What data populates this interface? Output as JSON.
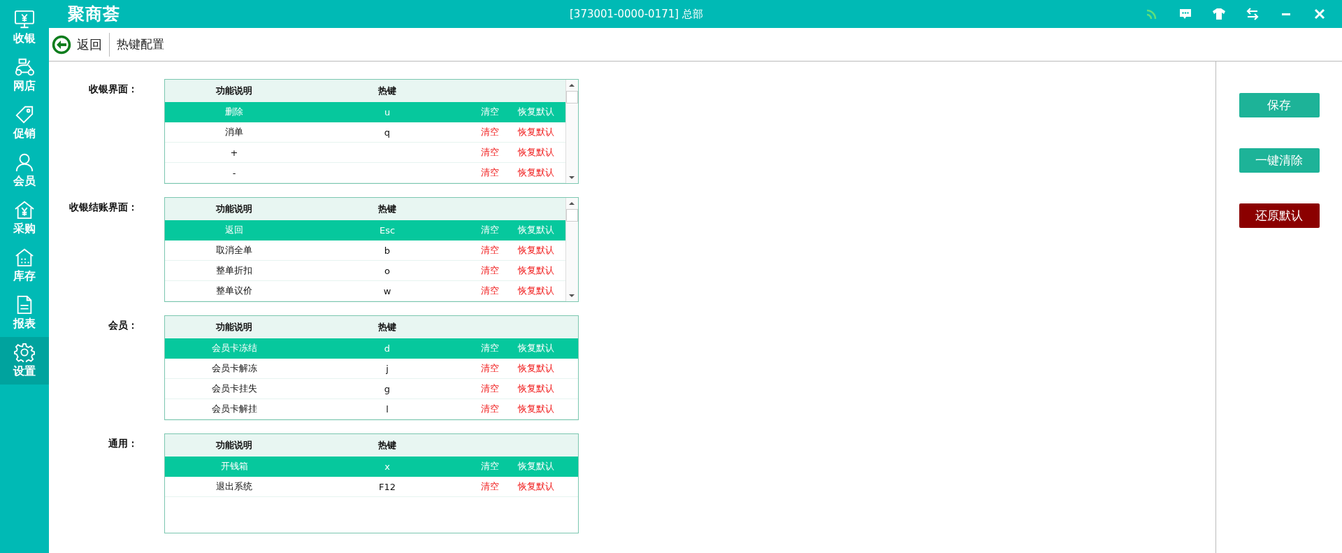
{
  "app": {
    "logo": "聚商荟",
    "store": "[373001-0000-0171] 总部"
  },
  "sidebar": {
    "items": [
      {
        "label": "收银",
        "kind": "register",
        "selected": false
      },
      {
        "label": "网店",
        "kind": "scooter",
        "selected": false
      },
      {
        "label": "促销",
        "kind": "tag",
        "selected": false
      },
      {
        "label": "会员",
        "kind": "person",
        "selected": false
      },
      {
        "label": "采购",
        "kind": "purchase",
        "selected": false
      },
      {
        "label": "库存",
        "kind": "warehouse",
        "selected": false
      },
      {
        "label": "报表",
        "kind": "report",
        "selected": false
      },
      {
        "label": "设置",
        "kind": "gear",
        "selected": true
      }
    ]
  },
  "header": {
    "back": "返回",
    "title": "热键配置"
  },
  "sections": [
    {
      "title": "收银界面：",
      "scrollbar": true,
      "columns": [
        "功能说明",
        "热键"
      ],
      "rows": [
        {
          "desc": "删除",
          "key": "u",
          "clear": "清空",
          "reset": "恢复默认",
          "selected": true
        },
        {
          "desc": "消单",
          "key": "q",
          "clear": "清空",
          "reset": "恢复默认",
          "selected": false
        },
        {
          "desc": "+",
          "clear": "清空",
          "reset": "恢复默认",
          "selected": false
        },
        {
          "desc": "-",
          "clear": "清空",
          "reset": "恢复默认",
          "selected": false
        }
      ]
    },
    {
      "title": "收银结账界面：",
      "scrollbar": true,
      "columns": [
        "功能说明",
        "热键"
      ],
      "rows": [
        {
          "desc": "返回",
          "key": "Esc",
          "clear": "清空",
          "reset": "恢复默认",
          "selected": true
        },
        {
          "desc": "取消全单",
          "key": "b",
          "clear": "清空",
          "reset": "恢复默认",
          "selected": false
        },
        {
          "desc": "整单折扣",
          "key": "o",
          "clear": "清空",
          "reset": "恢复默认",
          "selected": false
        },
        {
          "desc": "整单议价",
          "key": "w",
          "clear": "清空",
          "reset": "恢复默认",
          "selected": false
        }
      ]
    },
    {
      "title": "会员：",
      "scrollbar": false,
      "columns": [
        "功能说明",
        "热键"
      ],
      "rows": [
        {
          "desc": "会员卡冻结",
          "key": "d",
          "clear": "清空",
          "reset": "恢复默认",
          "selected": true
        },
        {
          "desc": "会员卡解冻",
          "key": "j",
          "clear": "清空",
          "reset": "恢复默认",
          "selected": false
        },
        {
          "desc": "会员卡挂失",
          "key": "g",
          "clear": "清空",
          "reset": "恢复默认",
          "selected": false
        },
        {
          "desc": "会员卡解挂",
          "key": "l",
          "clear": "清空",
          "reset": "恢复默认",
          "selected": false
        }
      ]
    },
    {
      "title": "通用：",
      "scrollbar": false,
      "columns": [
        "功能说明",
        "热键"
      ],
      "rows": [
        {
          "desc": "开钱箱",
          "key": "x",
          "clear": "清空",
          "reset": "恢复默认",
          "selected": true
        },
        {
          "desc": "退出系统",
          "key": "F12",
          "clear": "清空",
          "reset": "恢复默认",
          "selected": false
        }
      ]
    }
  ],
  "actions": [
    {
      "label": "保存",
      "kind": "primary"
    },
    {
      "label": "一键清除",
      "kind": "primary"
    },
    {
      "label": "还原默认",
      "kind": "danger"
    }
  ]
}
